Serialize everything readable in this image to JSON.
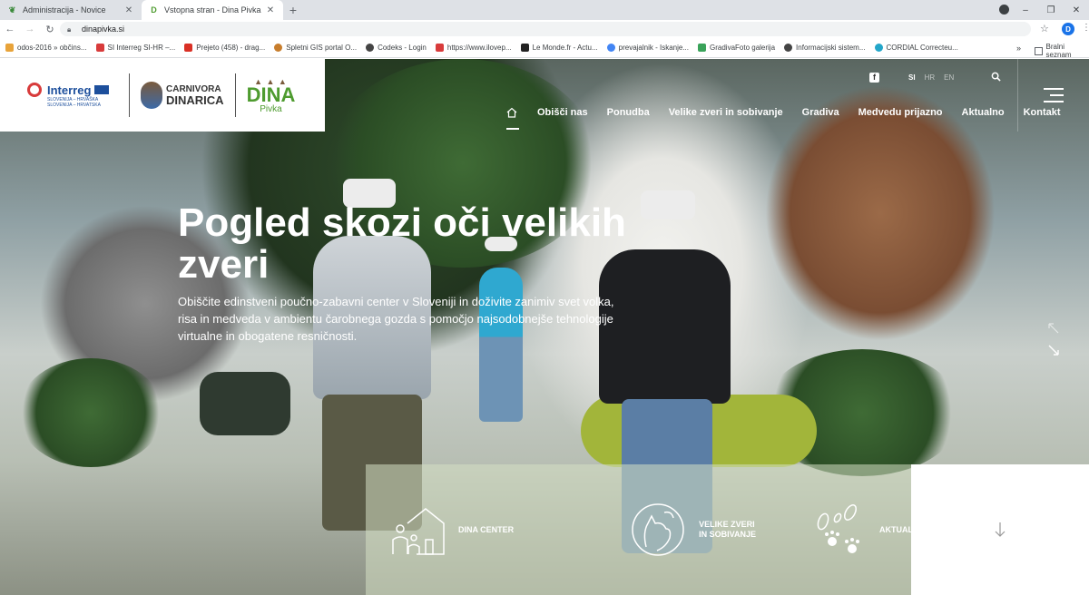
{
  "browser": {
    "tabs": [
      {
        "title": "Administracija - Novice",
        "active": false
      },
      {
        "title": "Vstopna stran - Dina Pivka",
        "active": true
      }
    ],
    "new_tab": "+",
    "window_controls": {
      "minimize": "–",
      "restore": "❐",
      "close": "✕"
    },
    "address": "dinapivka.si",
    "profile_initial": "D",
    "bookmarks": [
      {
        "label": "odos-2016 » občins...",
        "color": "#e8a33a"
      },
      {
        "label": "SI Interreg SI-HR –...",
        "color": "#d83b3b"
      },
      {
        "label": "Prejeto (458) - drag...",
        "color": "#d93025"
      },
      {
        "label": "Spletni GIS portal O...",
        "color": "#c77d2c"
      },
      {
        "label": "Codeks - Login",
        "color": "#444444"
      },
      {
        "label": "https://www.ilovep...",
        "color": "#d83b3b"
      },
      {
        "label": "Le Monde.fr - Actu...",
        "color": "#222222"
      },
      {
        "label": "prevajalnik - Iskanje...",
        "color": "#4285f4"
      },
      {
        "label": "GradivaFoto galerija",
        "color": "#3aa35a"
      },
      {
        "label": "Informacijski sistem...",
        "color": "#444444"
      },
      {
        "label": "CORDIAL Correcteu...",
        "color": "#23a6c9"
      }
    ],
    "bookmarks_more": "»",
    "reading_list": "Bralni seznam"
  },
  "site": {
    "logos": {
      "interreg_title": "Interreg",
      "interreg_sub": [
        "SLOVENIJA – HRVAŠKA",
        "SLOVENIJA – HRVATSKA"
      ],
      "carnivora_line1": "CARNIVORA",
      "carnivora_line2": "DINARICA",
      "dina_name": "DINA",
      "dina_sub": "Pivka"
    },
    "languages": [
      {
        "code": "SI",
        "active": true
      },
      {
        "code": "HR",
        "active": false
      },
      {
        "code": "EN",
        "active": false
      }
    ],
    "facebook_glyph": "f",
    "nav": [
      "Obišči nas",
      "Ponudba",
      "Velike zveri in sobivanje",
      "Gradiva",
      "Medvedu prijazno",
      "Aktualno",
      "Kontakt"
    ],
    "hero": {
      "title": "Pogled skozi oči velikih zveri",
      "text": "Obiščite edinstveni poučno-zabavni center v Sloveniji in doživite zanimiv svet volka, risa in medveda v ambientu čarobnega gozda s pomočjo najsodobnejše tehnologije virtualne in obogatene resničnosti."
    },
    "features": [
      {
        "label": "DINA CENTER",
        "icon": "house-family-icon"
      },
      {
        "label_line1": "VELIKE ZVERI",
        "label_line2": "IN SOBIVANJE",
        "icon": "bear-wolf-icon"
      },
      {
        "label": "AKTUALNO",
        "icon": "footprints-icon"
      }
    ],
    "colors": {
      "brand_green": "#4e9b2f",
      "interreg_blue": "#1d4f9c"
    }
  }
}
